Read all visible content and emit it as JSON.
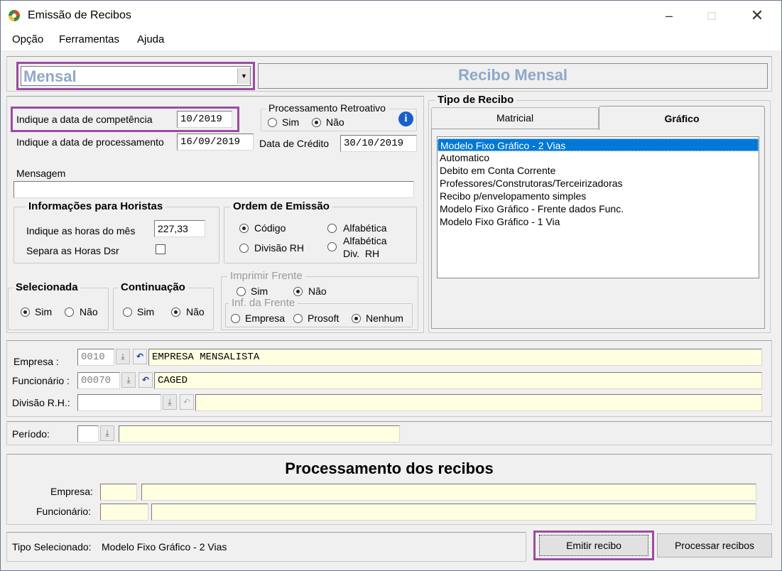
{
  "window": {
    "title": "Emissão de Recibos"
  },
  "menu": [
    "Opção",
    "Ferramentas",
    "Ajuda"
  ],
  "header": {
    "period_type": "Mensal",
    "banner": "Recibo Mensal"
  },
  "dates": {
    "competencia_label": "Indique a data de competência",
    "competencia_value": "10/2019",
    "processamento_label": "Indique a data de processamento",
    "processamento_value": "16/09/2019",
    "credito_label": "Data de Crédito",
    "credito_value": "30/10/2019"
  },
  "retroativo": {
    "title": "Processamento Retroativo",
    "sim": "Sim",
    "nao": "Não"
  },
  "mensagem": {
    "label": "Mensagem",
    "value": ""
  },
  "horistas": {
    "title": "Informações para Horistas",
    "horas_label": "Indique as horas do mês",
    "horas_value": "227,33",
    "separa_label": "Separa as Horas Dsr"
  },
  "ordem": {
    "title": "Ordem de Emissão",
    "codigo": "Código",
    "alfabetica": "Alfabética",
    "divisao": "Divisão RH",
    "alfa_div_1": "Alfabética",
    "alfa_div_2": "Div.  RH"
  },
  "selecionada": {
    "title": "Selecionada",
    "sim": "Sim",
    "nao": "Não"
  },
  "continuacao": {
    "title": "Continuação",
    "sim": "Sim",
    "nao": "Não"
  },
  "imprimir_frente": {
    "title": "Imprimir Frente",
    "sim": "Sim",
    "nao": "Não",
    "inf_title": "Inf. da Frente",
    "empresa": "Empresa",
    "prosoft": "Prosoft",
    "nenhum": "Nenhum"
  },
  "tipo_recibo": {
    "title": "Tipo de Recibo",
    "tab_matricial": "Matricial",
    "tab_grafico": "Gráfico",
    "items": [
      "Modelo Fixo Gráfico - 2 Vias",
      "Automatico",
      "Debito em Conta Corrente",
      "Professores/Construtoras/Terceirizadoras",
      "Recibo p/envelopamento simples",
      "Modelo Fixo Gráfico - Frente dados Func.",
      "Modelo Fixo Gráfico - 1 Via"
    ]
  },
  "filtros": {
    "empresa_label": "Empresa :",
    "empresa_code": "0010",
    "empresa_name": "EMPRESA MENSALISTA",
    "funcionario_label": "Funcionário :",
    "funcionario_code": "00070",
    "funcionario_name": "CAGED",
    "divisao_label": "Divisão R.H.:",
    "periodo_label": "Período:"
  },
  "processamento": {
    "title": "Processamento dos recibos",
    "empresa_label": "Empresa:",
    "funcionario_label": "Funcionário:"
  },
  "footer": {
    "tipo_label": "Tipo Selecionado:",
    "tipo_value": "Modelo Fixo Gráfico - 2 Vias",
    "emitir": "Emitir recibo",
    "processar": "Processar recibos"
  },
  "colors": {
    "highlight": "#9b4ca0",
    "banner_text": "#8fa8c8",
    "selection": "#0078d7",
    "field_yellow": "#ffffe1"
  }
}
